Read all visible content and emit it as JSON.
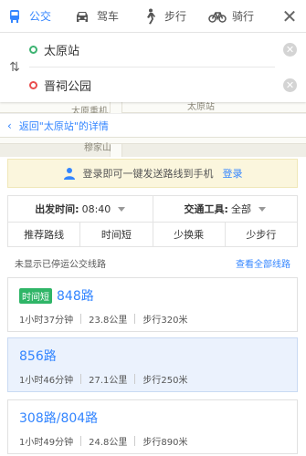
{
  "tabs": [
    {
      "label": "公交",
      "icon": "bus-icon",
      "active": true
    },
    {
      "label": "驾车",
      "icon": "car-icon",
      "active": false
    },
    {
      "label": "步行",
      "icon": "walk-icon",
      "active": false
    },
    {
      "label": "骑行",
      "icon": "bike-icon",
      "active": false
    }
  ],
  "close_symbol": "✕",
  "start": {
    "value": "太原站"
  },
  "end": {
    "value": "晋祠公园"
  },
  "swap_symbol": "⇅",
  "clear_symbol": "✕",
  "backlink": {
    "chevron": "‹",
    "text": "返回\"太原站\"的详情"
  },
  "map_labels": [
    "太原站",
    "太原重机",
    "穆家山"
  ],
  "login_bar": {
    "text": "登录即可一键发送路线到手机",
    "link": "登录"
  },
  "filter": {
    "depart_label": "出发时间:",
    "depart_value": "08:40",
    "mode_label": "交通工具:",
    "mode_value": "全部"
  },
  "sort": [
    "推荐路线",
    "时间短",
    "少换乘",
    "少步行"
  ],
  "note": {
    "text": "未显示已停运公交线路",
    "link": "查看全部线路"
  },
  "routes": [
    {
      "tag": "时间短",
      "line": "848路",
      "duration": "1小时37分钟",
      "distance": "23.8公里",
      "walk": "步行320米"
    },
    {
      "tag": "",
      "line": "856路",
      "duration": "1小时46分钟",
      "distance": "27.1公里",
      "walk": "步行250米"
    },
    {
      "tag": "",
      "line": "308路/804路",
      "duration": "1小时49分钟",
      "distance": "24.8公里",
      "walk": "步行890米"
    }
  ],
  "colors": {
    "accent": "#3385ff",
    "fast_tag": "#2fb567",
    "selected_bg": "#ebf2fd"
  }
}
